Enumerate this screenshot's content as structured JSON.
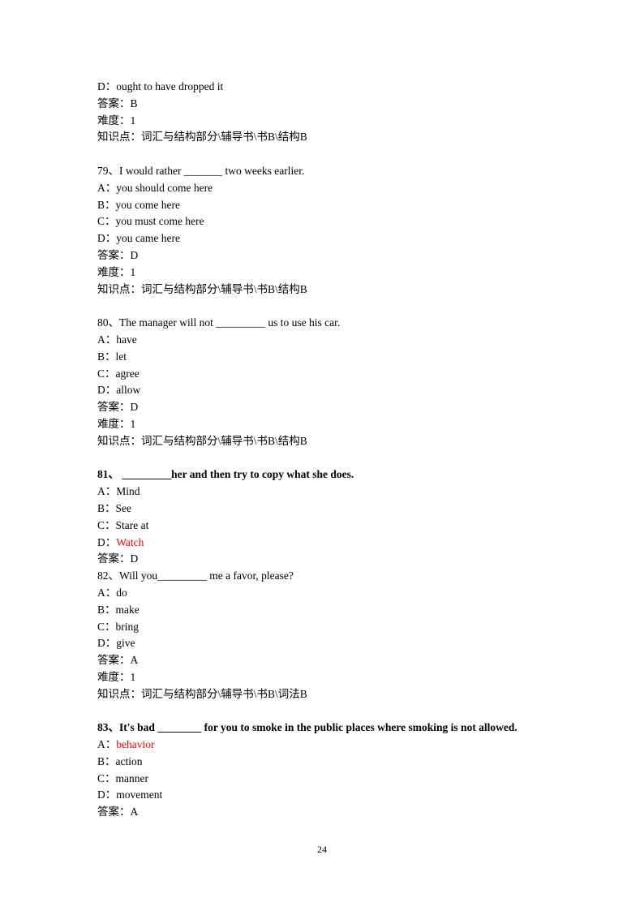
{
  "colors": {
    "highlight": "#ff0000",
    "text": "#000000"
  },
  "blocks": [
    {
      "id": "q78-tail",
      "bold": false,
      "lines": [
        {
          "label": "D：",
          "text": "ought to have dropped it"
        },
        {
          "label": "答案：",
          "text": "B"
        },
        {
          "label": "难度：",
          "text": "1"
        },
        {
          "label": "知识点：",
          "text": "词汇与结构部分\\辅导书\\书B\\结构B"
        }
      ]
    },
    {
      "id": "q79",
      "number": "79、",
      "stem_before": "I would rather ",
      "blank": "_______",
      "stem_after": " two weeks earlier.",
      "bold": false,
      "options": [
        {
          "label": "A：",
          "text": "you should come here",
          "highlight": false
        },
        {
          "label": "B：",
          "text": "you come here",
          "highlight": false
        },
        {
          "label": "C：",
          "text": "you must come here",
          "highlight": false
        },
        {
          "label": "D：",
          "text": "you came here",
          "highlight": false
        }
      ],
      "answer_label": "答案：",
      "answer": "D",
      "difficulty_label": "难度：",
      "difficulty": "1",
      "topic_label": "知识点：",
      "topic": "词汇与结构部分\\辅导书\\书B\\结构B"
    },
    {
      "id": "q80",
      "number": "80、",
      "stem_before": "The manager will not ",
      "blank": "_________",
      "stem_after": " us to use his car.",
      "bold": false,
      "options": [
        {
          "label": "A：",
          "text": "have",
          "highlight": false
        },
        {
          "label": "B：",
          "text": "let",
          "highlight": false
        },
        {
          "label": "C：",
          "text": "agree",
          "highlight": false
        },
        {
          "label": "D：",
          "text": "allow",
          "highlight": false
        }
      ],
      "answer_label": "答案：",
      "answer": "D",
      "difficulty_label": "难度：",
      "difficulty": "1",
      "topic_label": "知识点：",
      "topic": "词汇与结构部分\\辅导书\\书B\\结构B"
    },
    {
      "id": "q81",
      "number": "81、",
      "stem_before": " ",
      "blank": "_________",
      "stem_after": "her and then try to copy what she does.",
      "bold": true,
      "options": [
        {
          "label": "A：",
          "text": "Mind",
          "highlight": false
        },
        {
          "label": "B：",
          "text": "See",
          "highlight": false
        },
        {
          "label": "C：",
          "text": "Stare at",
          "highlight": false
        },
        {
          "label": "D：",
          "text": "Watch",
          "highlight": true
        }
      ],
      "answer_label": "答案：",
      "answer": "D"
    },
    {
      "id": "q82",
      "number": "82、",
      "stem_before": "Will you",
      "blank": "_________",
      "stem_after": " me a favor, please?",
      "bold": false,
      "options": [
        {
          "label": "A：",
          "text": "do",
          "highlight": false
        },
        {
          "label": "B：",
          "text": "make",
          "highlight": false
        },
        {
          "label": "C：",
          "text": "bring",
          "highlight": false
        },
        {
          "label": "D：",
          "text": "give",
          "highlight": false
        }
      ],
      "answer_label": "答案：",
      "answer": "A",
      "difficulty_label": "难度：",
      "difficulty": "1",
      "topic_label": "知识点：",
      "topic": "词汇与结构部分\\辅导书\\书B\\词法B"
    },
    {
      "id": "q83",
      "number": "83、",
      "stem_before": "It's bad ",
      "blank": "________",
      "stem_after": " for you to smoke in the public places where smoking is not allowed.",
      "bold": true,
      "options": [
        {
          "label": "A：",
          "text": "behavior",
          "highlight": true
        },
        {
          "label": "B：",
          "text": "action",
          "highlight": false
        },
        {
          "label": "C：",
          "text": "manner",
          "highlight": false
        },
        {
          "label": "D：",
          "text": "movement",
          "highlight": false
        }
      ],
      "answer_label": "答案：",
      "answer": "A"
    }
  ],
  "footer": {
    "page_number": "24"
  }
}
